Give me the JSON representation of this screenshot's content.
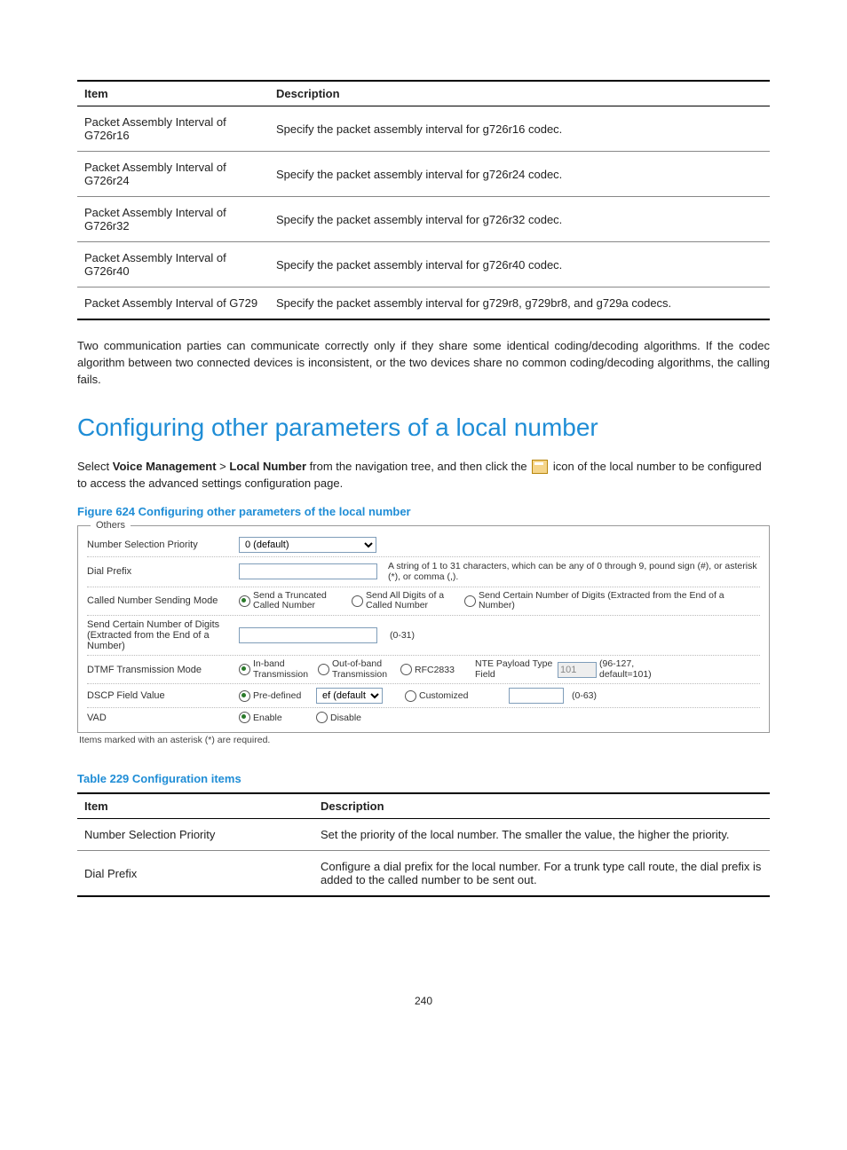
{
  "table1": {
    "headers": {
      "item": "Item",
      "desc": "Description"
    },
    "rows": [
      {
        "item": "Packet Assembly Interval of G726r16",
        "desc": "Specify the packet assembly interval for g726r16 codec."
      },
      {
        "item": "Packet Assembly Interval of G726r24",
        "desc": "Specify the packet assembly interval for g726r24 codec."
      },
      {
        "item": "Packet Assembly Interval of G726r32",
        "desc": "Specify the packet assembly interval for g726r32 codec."
      },
      {
        "item": "Packet Assembly Interval of G726r40",
        "desc": "Specify the packet assembly interval for g726r40 codec."
      },
      {
        "item": "Packet Assembly Interval of G729",
        "desc": "Specify the packet assembly interval for g729r8, g729br8, and g729a codecs."
      }
    ]
  },
  "paragraph1": "Two communication parties can communicate correctly only if they share some identical coding/decoding algorithms. If the codec algorithm between two connected devices is inconsistent, or the two devices share no common coding/decoding algorithms, the calling fails.",
  "heading": "Configuring other parameters of a local number",
  "intro": {
    "pre": "Select ",
    "b1": "Voice Management",
    "sep": " > ",
    "b2": "Local Number",
    "mid": " from the navigation tree, and then click the ",
    "post": " icon of the local number to be configured to access the advanced settings configuration page."
  },
  "figure_caption": "Figure 624 Configuring other parameters of the local number",
  "others": {
    "legend": "Others",
    "rows": {
      "nsp": {
        "label": "Number Selection Priority",
        "value": "0 (default)"
      },
      "dial": {
        "label": "Dial Prefix",
        "hint": "A string of 1 to 31 characters, which can be any of 0 through 9, pound sign (#), or asterisk (*), or comma (,)."
      },
      "csm": {
        "label": "Called Number Sending Mode",
        "opts": {
          "a": "Send a Truncated Called Number",
          "b": "Send All Digits of a Called Number",
          "c": "Send Certain Number of Digits (Extracted from the End of a Number)"
        }
      },
      "scnd": {
        "label": "Send Certain Number of Digits (Extracted from the End of a Number)",
        "hint": "(0-31)"
      },
      "dtmf": {
        "label": "DTMF Transmission Mode",
        "opts": {
          "a": "In-band Transmission",
          "b": "Out-of-band Transmission",
          "c": "RFC2833"
        },
        "nte_label": "NTE Payload Type Field",
        "nte_value": "101",
        "nte_hint": "(96-127, default=101)"
      },
      "dscp": {
        "label": "DSCP Field Value",
        "opts": {
          "a": "Pre-defined",
          "b": "Customized"
        },
        "sel": "ef (default)",
        "hint": "(0-63)"
      },
      "vad": {
        "label": "VAD",
        "opts": {
          "a": "Enable",
          "b": "Disable"
        }
      }
    }
  },
  "footnote": "Items marked with an asterisk (*) are required.",
  "table2caption": "Table 229 Configuration items",
  "table2": {
    "headers": {
      "item": "Item",
      "desc": "Description"
    },
    "rows": [
      {
        "item": "Number Selection Priority",
        "desc": "Set the priority of the local number. The smaller the value, the higher the priority."
      },
      {
        "item": "Dial Prefix",
        "desc": "Configure a dial prefix for the local number. For a trunk type call route, the dial prefix is added to the called number to be sent out."
      }
    ]
  },
  "pageno": "240"
}
